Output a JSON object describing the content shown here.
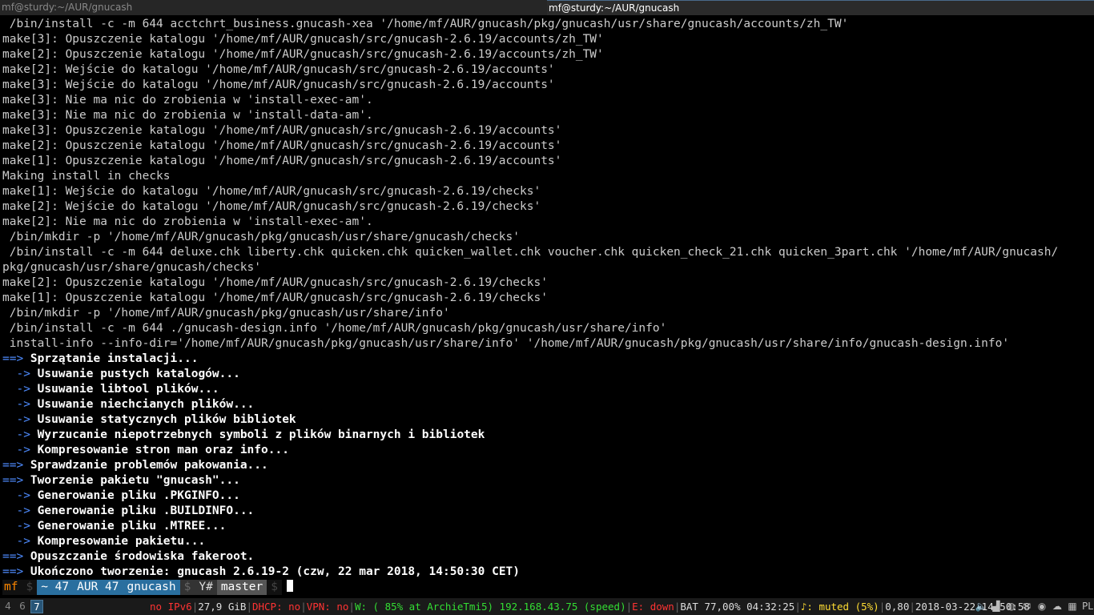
{
  "tabs": [
    {
      "title": "mf@sturdy:~/AUR/gnucash",
      "active": false
    },
    {
      "title": "mf@sturdy:~/AUR/gnucash",
      "active": true
    }
  ],
  "terminal": {
    "lines": [
      {
        "text": " /bin/install -c -m 644 acctchrt_business.gnucash-xea '/home/mf/AUR/gnucash/pkg/gnucash/usr/share/gnucash/accounts/zh_TW'"
      },
      {
        "text": "make[3]: Opuszczenie katalogu '/home/mf/AUR/gnucash/src/gnucash-2.6.19/accounts/zh_TW'"
      },
      {
        "text": "make[2]: Opuszczenie katalogu '/home/mf/AUR/gnucash/src/gnucash-2.6.19/accounts/zh_TW'"
      },
      {
        "text": "make[2]: Wejście do katalogu '/home/mf/AUR/gnucash/src/gnucash-2.6.19/accounts'"
      },
      {
        "text": "make[3]: Wejście do katalogu '/home/mf/AUR/gnucash/src/gnucash-2.6.19/accounts'"
      },
      {
        "text": "make[3]: Nie ma nic do zrobienia w 'install-exec-am'."
      },
      {
        "text": "make[3]: Nie ma nic do zrobienia w 'install-data-am'."
      },
      {
        "text": "make[3]: Opuszczenie katalogu '/home/mf/AUR/gnucash/src/gnucash-2.6.19/accounts'"
      },
      {
        "text": "make[2]: Opuszczenie katalogu '/home/mf/AUR/gnucash/src/gnucash-2.6.19/accounts'"
      },
      {
        "text": "make[1]: Opuszczenie katalogu '/home/mf/AUR/gnucash/src/gnucash-2.6.19/accounts'"
      },
      {
        "text": "Making install in checks"
      },
      {
        "text": "make[1]: Wejście do katalogu '/home/mf/AUR/gnucash/src/gnucash-2.6.19/checks'"
      },
      {
        "text": "make[2]: Wejście do katalogu '/home/mf/AUR/gnucash/src/gnucash-2.6.19/checks'"
      },
      {
        "text": "make[2]: Nie ma nic do zrobienia w 'install-exec-am'."
      },
      {
        "text": " /bin/mkdir -p '/home/mf/AUR/gnucash/pkg/gnucash/usr/share/gnucash/checks'"
      },
      {
        "text": " /bin/install -c -m 644 deluxe.chk liberty.chk quicken.chk quicken_wallet.chk voucher.chk quicken_check_21.chk quicken_3part.chk '/home/mf/AUR/gnucash/"
      },
      {
        "text": "pkg/gnucash/usr/share/gnucash/checks'"
      },
      {
        "text": "make[2]: Opuszczenie katalogu '/home/mf/AUR/gnucash/src/gnucash-2.6.19/checks'"
      },
      {
        "text": "make[1]: Opuszczenie katalogu '/home/mf/AUR/gnucash/src/gnucash-2.6.19/checks'"
      },
      {
        "text": " /bin/mkdir -p '/home/mf/AUR/gnucash/pkg/gnucash/usr/share/info'"
      },
      {
        "text": " /bin/install -c -m 644 ./gnucash-design.info '/home/mf/AUR/gnucash/pkg/gnucash/usr/share/info'"
      },
      {
        "text": " install-info --info-dir='/home/mf/AUR/gnucash/pkg/gnucash/usr/share/info' '/home/mf/AUR/gnucash/pkg/gnucash/usr/share/info/gnucash-design.info'"
      },
      {
        "prefix": "==> ",
        "text": "Sprzątanie instalacji..."
      },
      {
        "prefix": "  -> ",
        "text": "Usuwanie pustych katalogów..."
      },
      {
        "prefix": "  -> ",
        "text": "Usuwanie libtool plików..."
      },
      {
        "prefix": "  -> ",
        "text": "Usuwanie niechcianych plików..."
      },
      {
        "prefix": "  -> ",
        "text": "Usuwanie statycznych plików bibliotek"
      },
      {
        "prefix": "  -> ",
        "text": "Wyrzucanie niepotrzebnych symboli z plików binarnych i bibliotek"
      },
      {
        "prefix": "  -> ",
        "text": "Kompresowanie stron man oraz info..."
      },
      {
        "prefix": "==> ",
        "text": "Sprawdzanie problemów pakowania..."
      },
      {
        "prefix": "==> ",
        "text": "Tworzenie pakietu \"gnucash\"..."
      },
      {
        "prefix": "  -> ",
        "text": "Generowanie pliku .PKGINFO..."
      },
      {
        "prefix": "  -> ",
        "text": "Generowanie pliku .BUILDINFO..."
      },
      {
        "prefix": "  -> ",
        "text": "Generowanie pliku .MTREE..."
      },
      {
        "prefix": "  -> ",
        "text": "Kompresowanie pakietu..."
      },
      {
        "prefix": "==> ",
        "text": "Opuszczanie środowiska fakeroot."
      },
      {
        "prefix": "==> ",
        "text": "Ukończono tworzenie: gnucash 2.6.19-2 (czw, 22 mar 2018, 14:50:30 CET)"
      }
    ],
    "prompt": {
      "user": "mf",
      "dir": "~ 47",
      "aur": "AUR 47",
      "repo": "gnucash",
      "git": "Y#",
      "branch": "master",
      "sep": "$"
    }
  },
  "statusbar": {
    "workspaces": [
      {
        "label": "4",
        "active": false
      },
      {
        "label": "6",
        "active": false
      },
      {
        "label": "7",
        "active": true
      }
    ],
    "items": [
      {
        "text": "no IPv6",
        "color": "red"
      },
      {
        "text": "27,9 GiB",
        "color": "plain"
      },
      {
        "text": "DHCP: no",
        "color": "red"
      },
      {
        "text": "VPN: no",
        "color": "red"
      },
      {
        "text": "W: ( 85% at ArchieTmi5) 192.168.43.75 (speed)",
        "color": "green"
      },
      {
        "text": "E: down",
        "color": "red"
      },
      {
        "text": "BAT 77,00% 04:32:25",
        "color": "plain"
      },
      {
        "text": "♪: muted (5%)",
        "color": "yellow"
      },
      {
        "text": "0,80",
        "color": "plain"
      },
      {
        "text": "2018-03-22 14:50:58",
        "color": "plain"
      }
    ],
    "tray": [
      {
        "icon": "speaker-icon",
        "glyph": "🔈"
      },
      {
        "icon": "signal-icon",
        "glyph": "▟"
      },
      {
        "icon": "network-icon",
        "glyph": "◍"
      },
      {
        "icon": "mail-icon",
        "glyph": "✉"
      },
      {
        "icon": "discord-icon",
        "glyph": "◉"
      },
      {
        "icon": "cloud-icon",
        "glyph": "☁"
      },
      {
        "icon": "checker-icon",
        "glyph": "▦"
      },
      {
        "icon": "keyboard-layout-icon",
        "glyph": "PL"
      }
    ]
  }
}
